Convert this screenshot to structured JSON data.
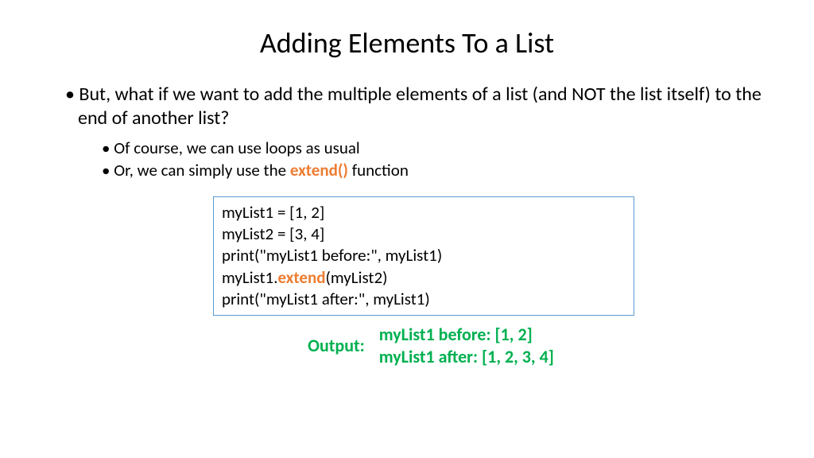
{
  "title": "Adding Elements To a List",
  "bullets": {
    "main": "But, what if we want to add the multiple elements of a list (and NOT the list itself) to the end of another list?",
    "sub1": "Of course, we can use loops as usual",
    "sub2_pre": "Or, we can simply use the ",
    "sub2_fn": "extend()",
    "sub2_post": " function"
  },
  "code": {
    "l1": "myList1 = [1, 2]",
    "l2": "myList2 = [3, 4]",
    "l3": "print(\"myList1 before:\", myList1)",
    "l4_pre": "myList1.",
    "l4_fn": "extend",
    "l4_post": "(myList2)",
    "l5": "print(\"myList1 after:\", myList1)"
  },
  "output": {
    "label": "Output:",
    "l1": "myList1 before: [1, 2]",
    "l2": "myList1 after: [1, 2, 3, 4]"
  }
}
